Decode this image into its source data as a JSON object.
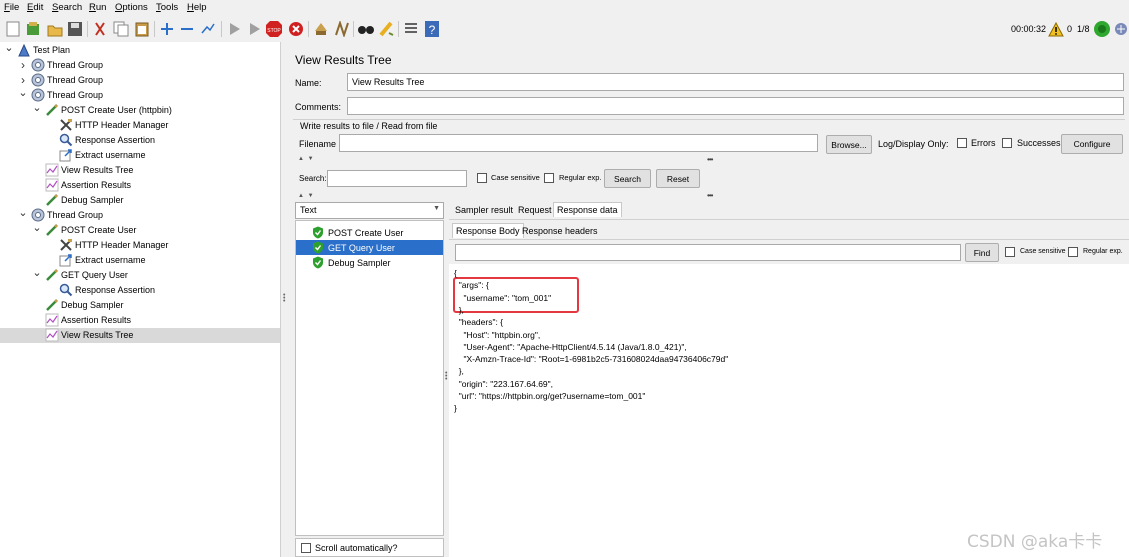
{
  "menu": [
    "File",
    "Edit",
    "Search",
    "Run",
    "Options",
    "Tools",
    "Help"
  ],
  "toolbar": {
    "icons": [
      "new-icon",
      "templates-icon",
      "open-icon",
      "save-icon",
      "cut-icon",
      "copy-icon",
      "paste-icon",
      "expand-icon",
      "collapse-icon",
      "toggle-icon",
      "start-icon",
      "start-no-pauses-icon",
      "stop-icon",
      "shutdown-icon",
      "clear-icon",
      "clear-all-icon",
      "search-icon",
      "reset-search-icon",
      "function-helper-icon",
      "help-icon"
    ],
    "elapsed_time": "00:00:32",
    "warning_count": "0",
    "threads": "1/8"
  },
  "tree": [
    {
      "label": "Test Plan",
      "icon": "test-plan-icon",
      "depth": 0,
      "twisty": "v"
    },
    {
      "label": "Thread Group",
      "icon": "thread-group-icon",
      "depth": 1,
      "twisty": ">"
    },
    {
      "label": "Thread Group",
      "icon": "thread-group-icon",
      "depth": 1,
      "twisty": ">"
    },
    {
      "label": "Thread Group",
      "icon": "thread-group-icon",
      "depth": 1,
      "twisty": "v"
    },
    {
      "label": "POST Create User (httpbin)",
      "icon": "sampler-icon",
      "depth": 2,
      "twisty": "v"
    },
    {
      "label": "HTTP Header Manager",
      "icon": "config-icon",
      "depth": 3,
      "twisty": ""
    },
    {
      "label": "Response Assertion",
      "icon": "assertion-icon",
      "depth": 3,
      "twisty": ""
    },
    {
      "label": "Extract username",
      "icon": "extractor-icon",
      "depth": 3,
      "twisty": ""
    },
    {
      "label": "View Results Tree",
      "icon": "listener-icon",
      "depth": 2,
      "twisty": ""
    },
    {
      "label": "Assertion Results",
      "icon": "listener-icon",
      "depth": 2,
      "twisty": ""
    },
    {
      "label": "Debug Sampler",
      "icon": "sampler-icon",
      "depth": 2,
      "twisty": ""
    },
    {
      "label": "Thread Group",
      "icon": "thread-group-icon",
      "depth": 1,
      "twisty": "v"
    },
    {
      "label": "POST Create User",
      "icon": "sampler-icon",
      "depth": 2,
      "twisty": "v"
    },
    {
      "label": "HTTP Header Manager",
      "icon": "config-icon",
      "depth": 3,
      "twisty": ""
    },
    {
      "label": "Extract username",
      "icon": "extractor-icon",
      "depth": 3,
      "twisty": ""
    },
    {
      "label": "GET Query User",
      "icon": "sampler-icon",
      "depth": 2,
      "twisty": "v"
    },
    {
      "label": "Response Assertion",
      "icon": "assertion-icon",
      "depth": 3,
      "twisty": ""
    },
    {
      "label": "Debug Sampler",
      "icon": "sampler-icon",
      "depth": 2,
      "twisty": ""
    },
    {
      "label": "Assertion Results",
      "icon": "listener-icon",
      "depth": 2,
      "twisty": ""
    },
    {
      "label": "View Results Tree",
      "icon": "listener-icon",
      "depth": 2,
      "twisty": "",
      "selected": true
    }
  ],
  "panel": {
    "title": "View Results Tree",
    "name_label": "Name:",
    "name_value": "View Results Tree",
    "comments_label": "Comments:",
    "comments_value": "",
    "write_results_label": "Write results to file / Read from file",
    "filename_label": "Filename",
    "filename_value": "",
    "browse_label": "Browse...",
    "log_display_label": "Log/Display Only:",
    "errors_label": "Errors",
    "successes_label": "Successes",
    "configure_label": "Configure",
    "search_label": "Search:",
    "search_value": "",
    "case_sensitive_label": "Case sensitive",
    "regular_exp_label": "Regular exp.",
    "search_button": "Search",
    "reset_button": "Reset"
  },
  "results": {
    "renderer": "Text",
    "items": [
      {
        "label": "POST Create User",
        "status": "success",
        "selected": false
      },
      {
        "label": "GET Query User",
        "status": "success",
        "selected": true
      },
      {
        "label": "Debug Sampler",
        "status": "success",
        "selected": false
      }
    ],
    "scroll_auto_label": "Scroll automatically?"
  },
  "detail": {
    "tabs": [
      "Sampler result",
      "Request",
      "Response data"
    ],
    "active_tab": "Response data",
    "subtabs": [
      "Response Body",
      "Response headers"
    ],
    "active_subtab": "Response Body",
    "find_value": "",
    "find_label": "Find",
    "case_sensitive_label": "Case sensitive",
    "regular_exp_label": "Regular exp.",
    "body_lines": [
      "{",
      "  \"args\": {",
      "    \"username\": \"tom_001\"",
      "  },",
      "  \"headers\": {",
      "    \"Host\": \"httpbin.org\",",
      "    \"User-Agent\": \"Apache-HttpClient/4.5.14 (Java/1.8.0_421)\",",
      "    \"X-Amzn-Trace-Id\": \"Root=1-6981b2c5-731608024daa94736406c79d\"",
      "  },",
      "  \"origin\": \"223.167.64.69\",",
      "  \"url\": \"https://httpbin.org/get?username=tom_001\"",
      "}"
    ]
  },
  "watermark": "CSDN @aka卡卡",
  "colors": {
    "selection": "#2a6fc9",
    "highlight_box": "#e5373f",
    "tree_selected": "#d9d9d9"
  }
}
